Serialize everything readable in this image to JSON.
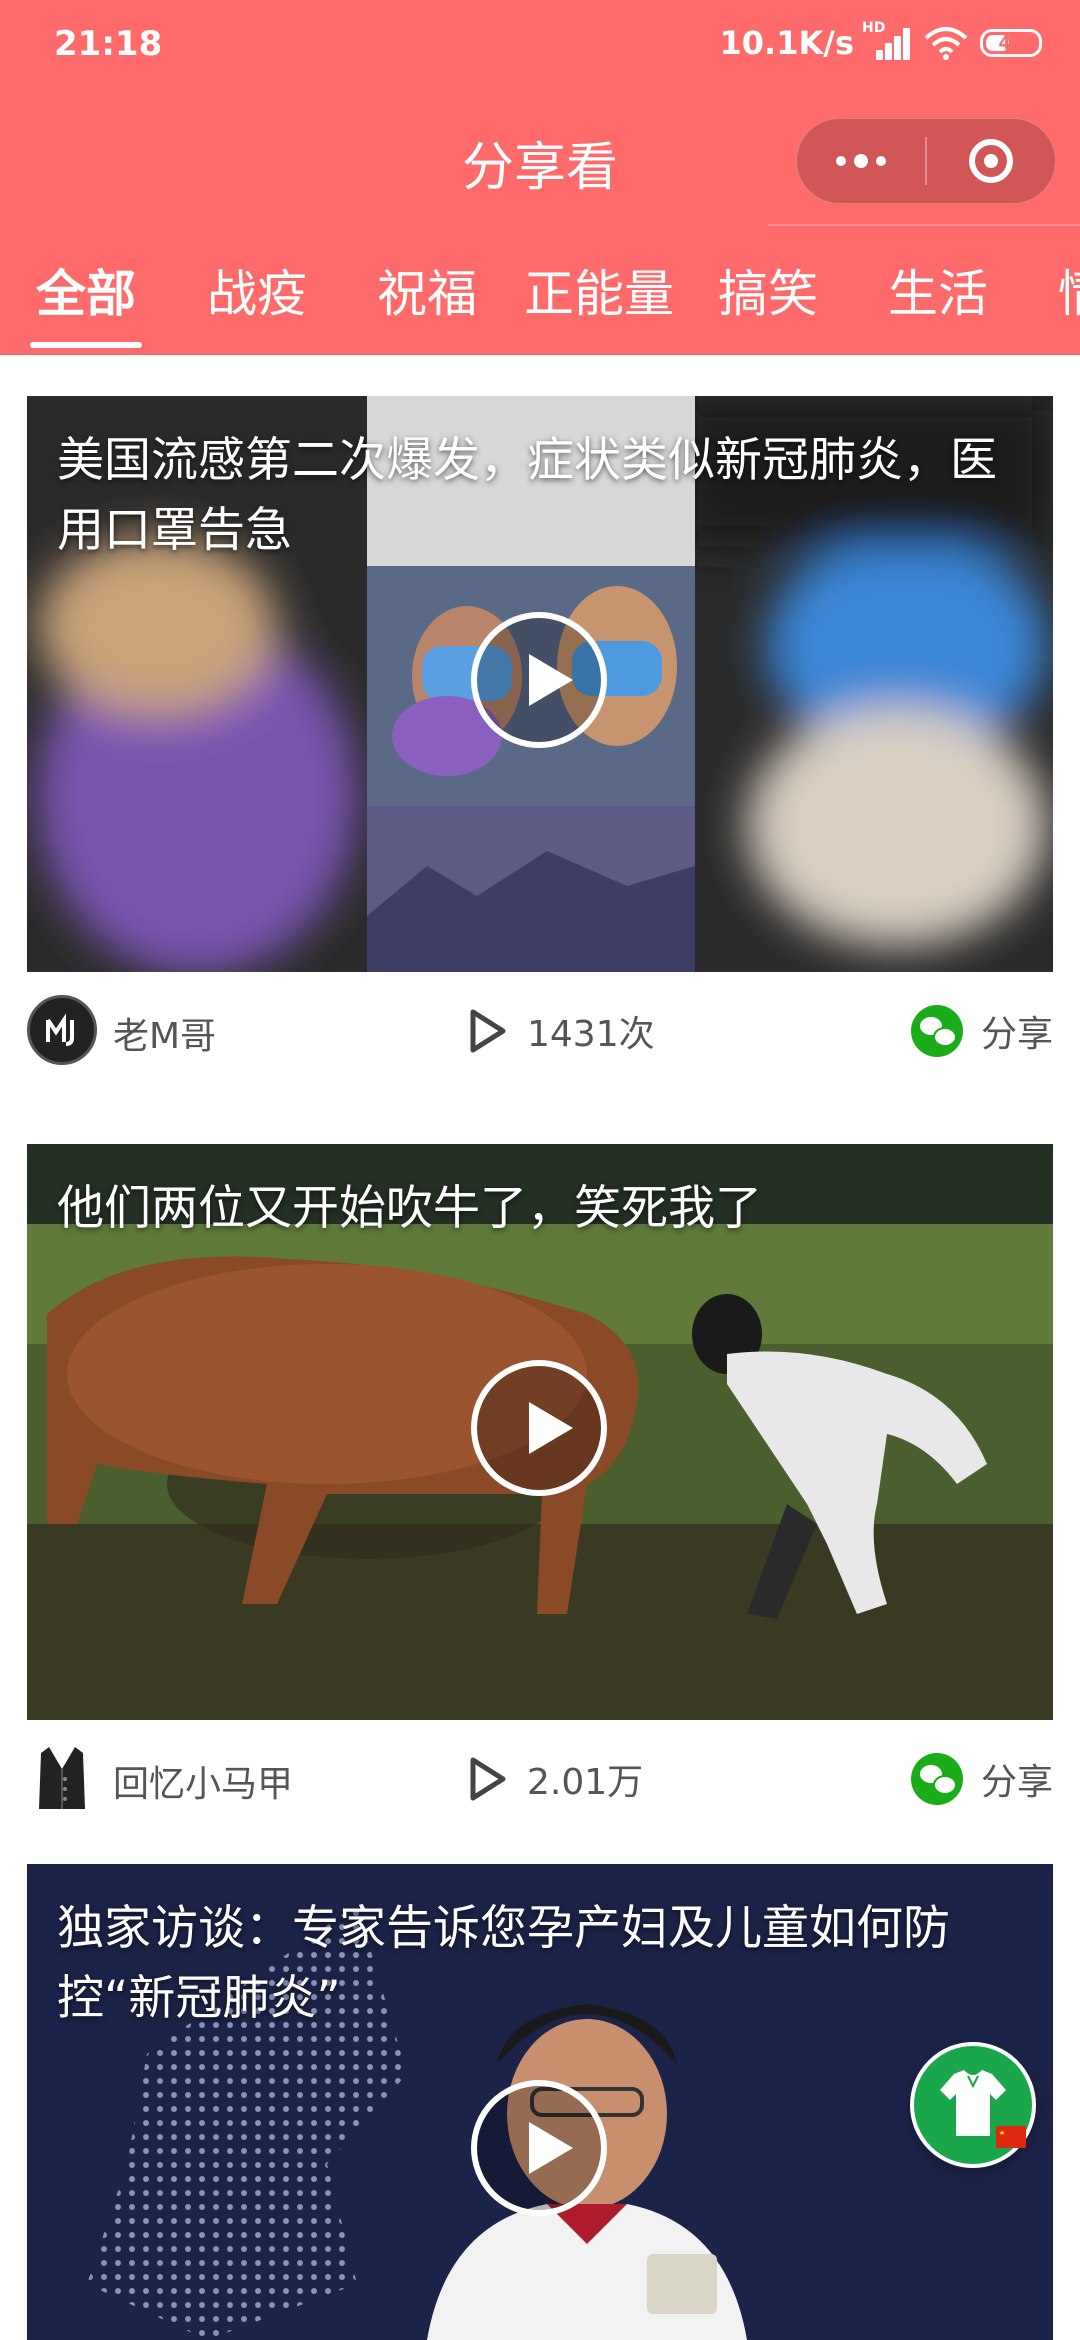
{
  "status": {
    "time": "21:18",
    "speed": "10.1K/s",
    "hd": "HD",
    "battery": "41"
  },
  "header": {
    "title": "分享看"
  },
  "tabs": [
    {
      "label": "全部"
    },
    {
      "label": "战疫"
    },
    {
      "label": "祝福"
    },
    {
      "label": "正能量"
    },
    {
      "label": "搞笑"
    },
    {
      "label": "生活"
    },
    {
      "label": "情"
    }
  ],
  "feed": [
    {
      "title": "美国流感第二次爆发，症状类似新冠肺炎，医用口罩告急",
      "author": "老M哥",
      "views": "1431次",
      "share": "分享"
    },
    {
      "title": "他们两位又开始吹牛了，笑死我了",
      "author": "回忆小马甲",
      "views": "2.01万",
      "share": "分享"
    },
    {
      "title": "独家访谈：专家告诉您孕产妇及儿童如何防控“新冠肺炎”"
    }
  ],
  "colors": {
    "accent": "#ff6b6b",
    "wechat": "#1aad19",
    "float": "#1aa64b"
  }
}
